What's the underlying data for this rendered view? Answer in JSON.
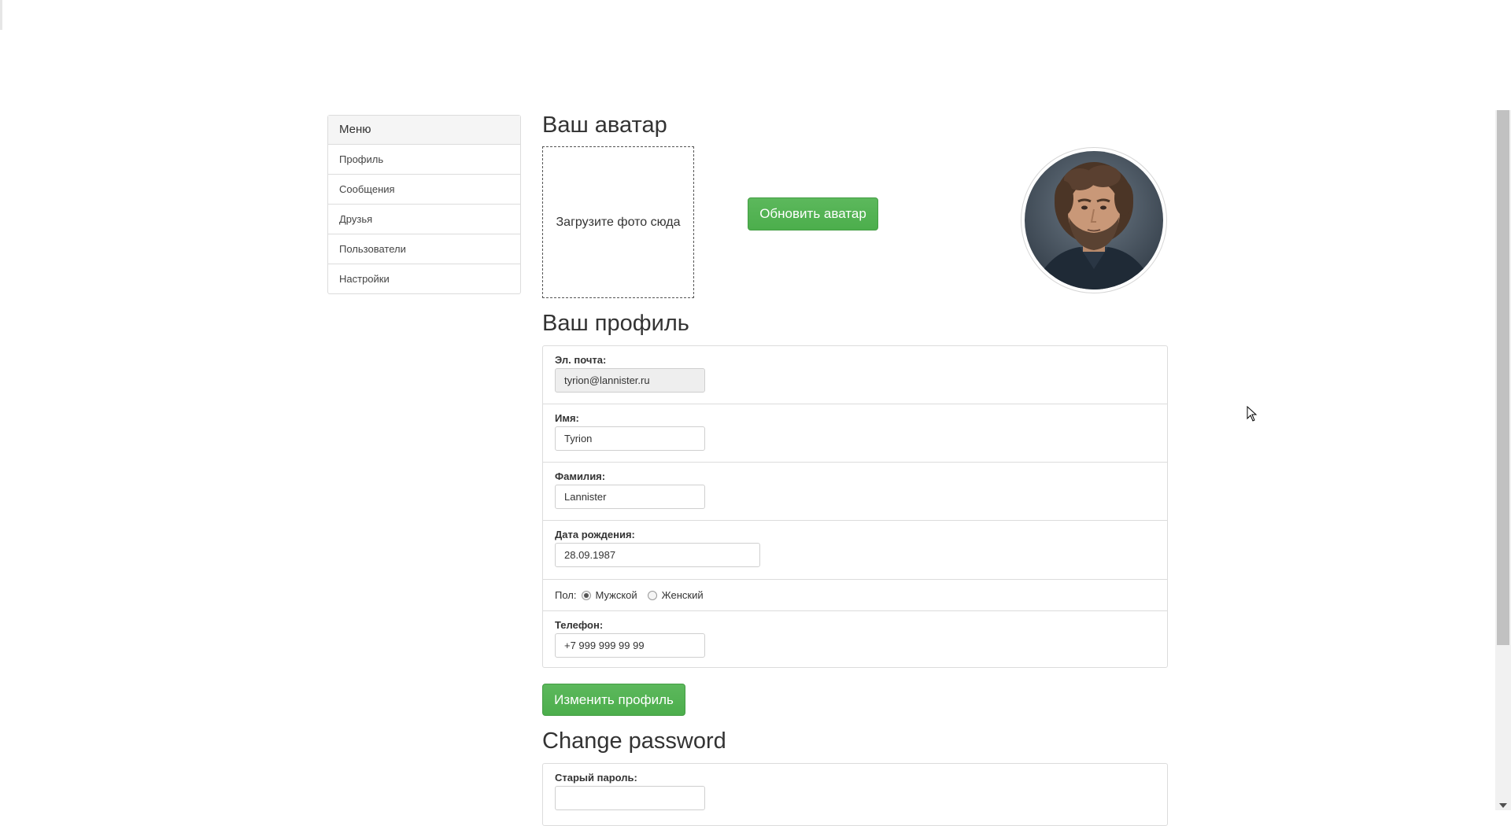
{
  "sidebar": {
    "title": "Меню",
    "items": [
      "Профиль",
      "Сообщения",
      "Друзья",
      "Пользователи",
      "Настройки"
    ]
  },
  "avatar_section": {
    "heading": "Ваш аватар",
    "dropzone_text": "Загрузите фото сюда",
    "update_button": "Обновить аватар"
  },
  "profile_section": {
    "heading": "Ваш профиль",
    "email_label": "Эл. почта:",
    "email_value": "tyrion@lannister.ru",
    "first_name_label": "Имя:",
    "first_name_value": "Tyrion",
    "last_name_label": "Фамилия:",
    "last_name_value": "Lannister",
    "birthdate_label": "Дата рождения:",
    "birthdate_value": "28.09.1987",
    "gender_label": "Пол:",
    "gender_male": "Мужской",
    "gender_female": "Женский",
    "gender_selected": "Мужской",
    "phone_label": "Телефон:",
    "phone_value": "+7 999 999 99 99",
    "save_button": "Изменить профиль"
  },
  "password_section": {
    "heading": "Change password",
    "old_password_label": "Старый пароль:",
    "old_password_value": ""
  },
  "colors": {
    "button_green": "#5cb85c",
    "panel_border": "#dcdcdc"
  },
  "icons": {
    "cursor": "mouse-pointer-icon",
    "scroll_down": "chevron-down-icon"
  }
}
